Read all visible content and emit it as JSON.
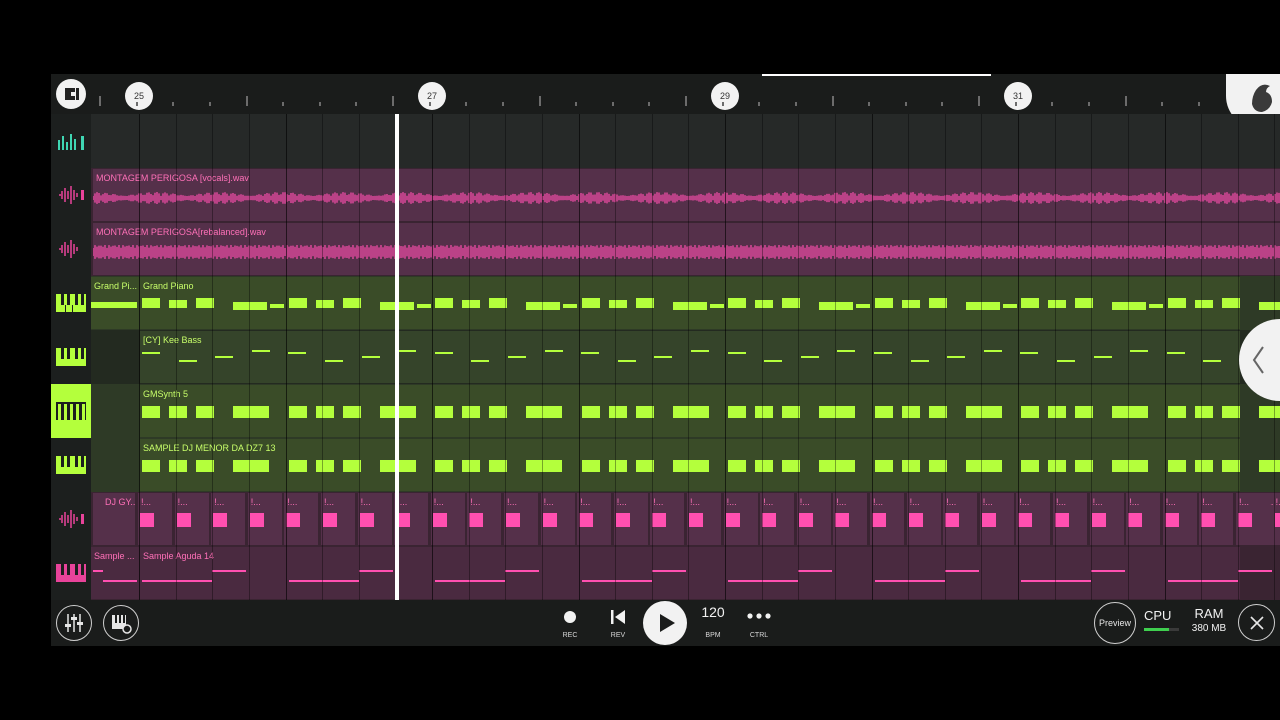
{
  "ruler": {
    "bars": [
      "25",
      "27",
      "29",
      "31"
    ]
  },
  "tracks": [
    {
      "type": "icon-only",
      "icon": "playlist-icon"
    },
    {
      "type": "audio",
      "icon": "waveform-icon",
      "clip_label": "MONTAGEM PERIGOSA [vocals].wav"
    },
    {
      "type": "audio",
      "icon": "waveform-icon",
      "clip_label": "MONTAGEM PERIGOSA[rebalanced].wav"
    },
    {
      "type": "pattern",
      "icon": "piano-keys-icon",
      "clip_labels": [
        "Grand Pi...",
        "Grand Piano"
      ]
    },
    {
      "type": "pattern",
      "icon": "piano-keys-icon",
      "clip_labels": [
        "[CY] Kee Bass"
      ]
    },
    {
      "type": "pattern",
      "icon": "piano-keys-icon",
      "clip_labels": [
        "GMSynth 5"
      ]
    },
    {
      "type": "pattern",
      "icon": "piano-keys-icon",
      "clip_labels": [
        "SAMPLE DJ MENOR DA DZ7 13"
      ]
    },
    {
      "type": "audio-slices",
      "icon": "waveform-icon",
      "clip_labels": [
        "DJ GY...",
        "!...",
        "DJ GY..."
      ]
    },
    {
      "type": "pattern",
      "icon": "piano-keys-icon",
      "clip_labels": [
        "Sample ...",
        "Sample Aguda 14"
      ]
    }
  ],
  "transport": {
    "rec_label": "REC",
    "rev_label": "REV",
    "bpm_value": "120",
    "bpm_label": "BPM",
    "ctrl_label": "CTRL",
    "preview_label": "Preview",
    "cpu_label": "CPU",
    "ram_label": "RAM",
    "ram_value": "380 MB"
  },
  "colors": {
    "audio": "#e8439a",
    "pattern": "#b4ff3c",
    "selected_track": "#b4ff3c"
  }
}
